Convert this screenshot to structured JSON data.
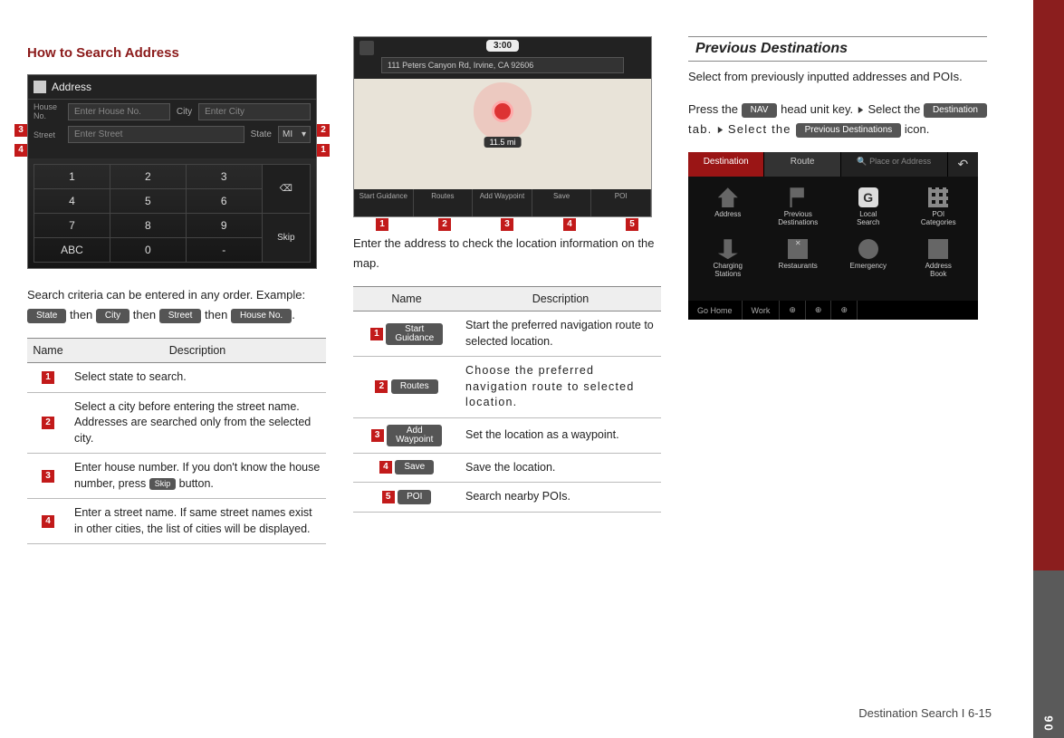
{
  "footer": "Destination Search I 6-15",
  "rail_number": "06",
  "col1": {
    "heading": "How to Search Address",
    "address_header": "Address",
    "row1": {
      "label_house": "House\nNo.",
      "ph_house": "Enter House No.",
      "label_city": "City",
      "ph_city": "Enter City"
    },
    "row2": {
      "label_street": "Street",
      "ph_street": "Enter Street",
      "label_state": "State",
      "state_val": "MI"
    },
    "keypad": [
      [
        "1",
        "2",
        "3"
      ],
      [
        "4",
        "5",
        "6"
      ],
      [
        "7",
        "8",
        "9"
      ],
      [
        "ABC",
        "0",
        "-"
      ]
    ],
    "keypad_side_top": "⌫",
    "keypad_side_bot": "Skip",
    "callouts": {
      "c1": "1",
      "c2": "2",
      "c3": "3",
      "c4": "4"
    },
    "intro_a": "Search criteria can be entered in any order. Example:",
    "btn_state": "State",
    "then1": "then",
    "btn_city": "City",
    "then2": "then",
    "btn_street": "Street",
    "then3": "then",
    "btn_house": "House No.",
    "period": ".",
    "table_hdr_name": "Name",
    "table_hdr_desc": "Description",
    "rows": [
      {
        "n": "1",
        "d": "Select state to search."
      },
      {
        "n": "2",
        "d": "Select a city before entering the street name. Addresses are searched only from the selected city."
      },
      {
        "n": "3",
        "d_pre": "Enter house number. If you don't know the house number, press ",
        "d_btn": "Skip",
        "d_post": " button."
      },
      {
        "n": "4",
        "d": "Enter a street name. If same street names exist in other cities, the list of cities will be displayed."
      }
    ]
  },
  "col2": {
    "clock": "3:00",
    "address": "111 Peters Canyon Rd, Irvine, CA 92606",
    "distance": "11.5 mi",
    "bottom_btns": [
      "Start\nGuidance",
      "Routes",
      "Add\nWaypoint",
      "Save",
      "POI"
    ],
    "callouts": [
      "1",
      "2",
      "3",
      "4",
      "5"
    ],
    "caption": "Enter the address to check the location information on the map.",
    "table_hdr_name": "Name",
    "table_hdr_desc": "Description",
    "rows": [
      {
        "n": "1",
        "btn": "Start\nGuidance",
        "d": "Start the preferred navigation route to selected location."
      },
      {
        "n": "2",
        "btn": "Routes",
        "d": "Choose the preferred navigation route to selected location."
      },
      {
        "n": "3",
        "btn": "Add\nWaypoint",
        "d": "Set the location as a waypoint."
      },
      {
        "n": "4",
        "btn": "Save",
        "d": "Save the location."
      },
      {
        "n": "5",
        "btn": "POI",
        "d": "Search nearby POIs."
      }
    ]
  },
  "col3": {
    "section_title": "Previous Destinations",
    "intro": "Select from previously inputted addresses and POIs.",
    "press_a": "Press the ",
    "btn_nav": "NAV",
    "press_b": " head unit key. ",
    "select_a": " Select the ",
    "btn_dest": "Destination",
    "tab_word": " tab. ",
    "select_b": " Select the ",
    "btn_prev": "Previous Destinations",
    "icon_word": " icon.",
    "tabs": {
      "dest": "Destination",
      "route": "Route",
      "search": "Place or Address",
      "back": "↶"
    },
    "grid": [
      "Address",
      "Previous\nDestinations",
      "Local\nSearch",
      "POI\nCategories",
      "Charging\nStations",
      "Restaurants",
      "Emergency",
      "Address\nBook"
    ],
    "bottom": [
      "Go Home",
      "Work",
      "⊕",
      "⊕",
      "⊕"
    ]
  }
}
